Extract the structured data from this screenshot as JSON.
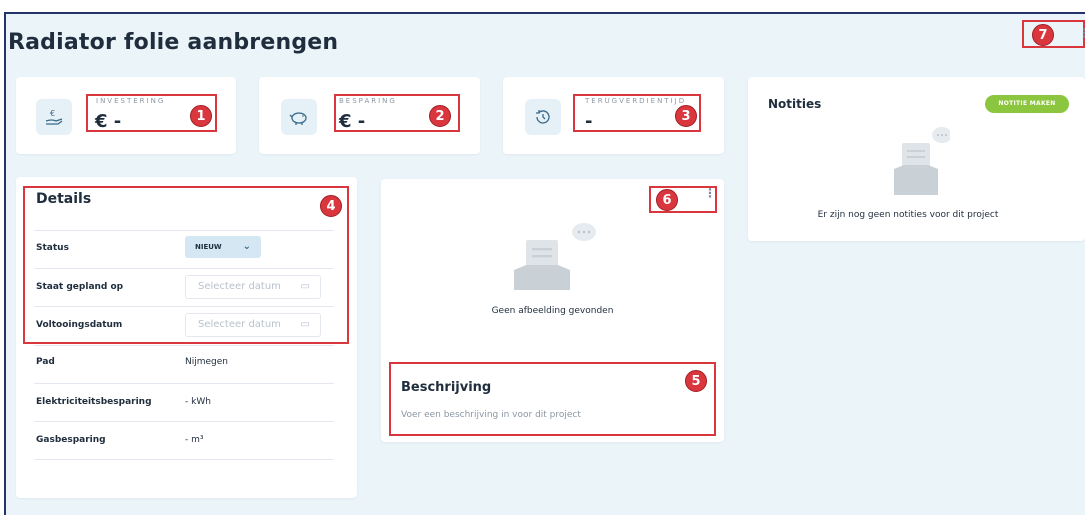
{
  "page": {
    "title": "Radiator folie aanbrengen"
  },
  "kpis": [
    {
      "label": "INVESTERING",
      "value": "€ -",
      "icon": "hand-euro-icon"
    },
    {
      "label": "BESPARING",
      "value": "€ -",
      "icon": "piggy-bank-icon"
    },
    {
      "label": "TERUGVERDIENTIJD",
      "value": "-",
      "icon": "clock-history-icon"
    }
  ],
  "details": {
    "title": "Details",
    "rows": [
      {
        "label": "Status",
        "value": "NIEUW"
      },
      {
        "label": "Staat gepland op",
        "placeholder": "Selecteer datum"
      },
      {
        "label": "Voltooingsdatum",
        "placeholder": "Selecteer datum"
      },
      {
        "label": "Pad",
        "value": "Nijmegen"
      },
      {
        "label": "Elektriciteitsbesparing",
        "value": "- kWh"
      },
      {
        "label": "Gasbesparing",
        "value": "- m³"
      }
    ]
  },
  "image_card": {
    "empty_text": "Geen afbeelding gevonden",
    "description_title": "Beschrijving",
    "description_placeholder": "Voer een beschrijving in voor dit project"
  },
  "notes": {
    "title": "Notities",
    "button_label": "NOTITIE MAKEN",
    "empty_text": "Er zijn nog geen notities voor dit project"
  },
  "annotations": [
    "1",
    "2",
    "3",
    "4",
    "5",
    "6",
    "7"
  ],
  "colors": {
    "accent_red": "#d9363e",
    "button_green": "#8cc63f",
    "background": "#eaf4f9",
    "frame": "#24346a"
  }
}
